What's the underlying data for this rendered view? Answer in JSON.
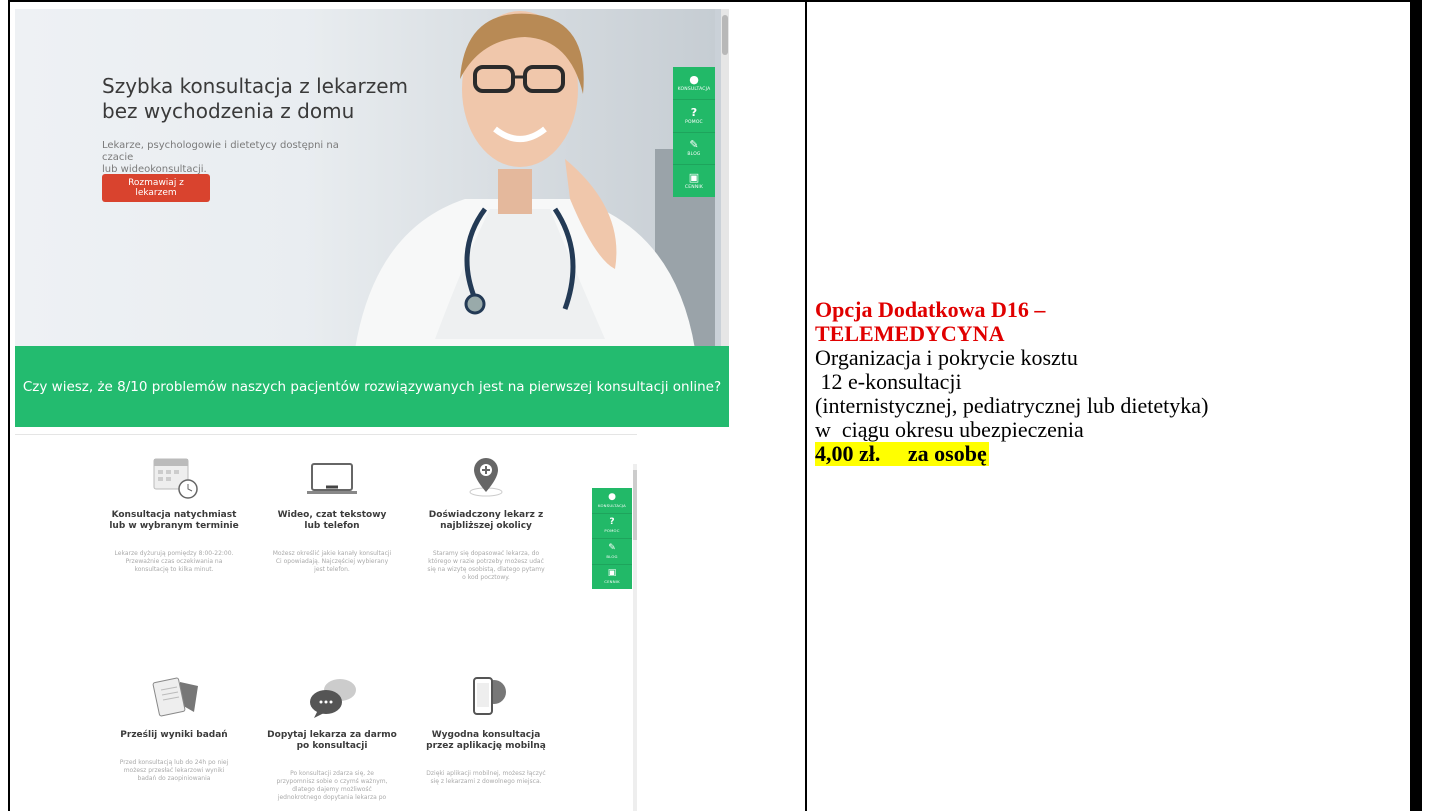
{
  "hero": {
    "title_line1": "Szybka konsultacja z lekarzem",
    "title_line2": "bez wychodzenia z domu",
    "subtitle_line1": "Lekarze, psychologowie i dietetycy dostępni na czacie",
    "subtitle_line2": "lub wideokonsultacji.",
    "cta_label": "Rozmawiaj z lekarzem",
    "band_text": "Czy wiesz, że 8/10 problemów naszych pacjentów rozwiązywanych jest na pierwszej konsultacji online?"
  },
  "sidebar": {
    "items": [
      {
        "label": "KONSULTACJA",
        "icon": "chat-bubble-icon"
      },
      {
        "label": "POMOC",
        "icon": "question-icon"
      },
      {
        "label": "BLOG",
        "icon": "edit-icon"
      },
      {
        "label": "CENNIK",
        "icon": "money-icon"
      }
    ]
  },
  "features": [
    {
      "icon": "calendar-clock-icon",
      "title_line1": "Konsultacja natychmiast",
      "title_line2": "lub w wybranym terminie",
      "desc": [
        "Lekarze dyżurują pomiędzy 8:00-22:00.",
        "Przeważnie czas oczekiwania na",
        "konsultację to kilka minut."
      ]
    },
    {
      "icon": "laptop-icon",
      "title_line1": "Wideo, czat tekstowy",
      "title_line2": "lub telefon",
      "desc": [
        "Możesz określić jakie kanały konsultacji",
        "Ci opowiadają. Najczęściej wybierany",
        "jest telefon."
      ]
    },
    {
      "icon": "location-pin-icon",
      "title_line1": "Doświadczony lekarz z",
      "title_line2": "najbliższej okolicy",
      "desc": [
        "Staramy się dopasować lekarza, do",
        "którego w razie potrzeby możesz udać",
        "się na wizytę osobistą, dlatego pytamy",
        "o kod pocztowy."
      ]
    },
    {
      "icon": "clipboard-icon",
      "title_line1": "Prześlij wyniki badań",
      "title_line2": "",
      "desc": [
        "Przed konsultacją lub do 24h po niej",
        "możesz przesłać lekarzowi wyniki",
        "badań do zaopiniowania"
      ]
    },
    {
      "icon": "speech-bubbles-icon",
      "title_line1": "Dopytaj lekarza za darmo",
      "title_line2": "po konsultacji",
      "desc": [
        "Po konsultacji zdarza się, że",
        "przypomnisz sobie o czymś ważnym,",
        "dlatego dajemy możliwość",
        "jednokrotnego dopytania lekarza po"
      ]
    },
    {
      "icon": "mobile-globe-icon",
      "title_line1": "Wygodna konsultacja",
      "title_line2": "przez aplikację mobilną",
      "desc": [
        "Dzięki aplikacji mobilnej, możesz łączyć",
        "się z lekarzami z dowolnego miejsca."
      ]
    }
  ],
  "offer": {
    "title_line1": "Opcja Dodatkowa D16 –",
    "title_line2": "TELEMEDYCYNA",
    "line1": "Organizacja i pokrycie kosztu",
    "line2": " 12 e-konsultacji",
    "line3": "(internistycznej, pediatrycznej lub dietetyka)",
    "line4": "w  ciągu okresu ubezpieczenia",
    "price": "4,00 zł.     za osobę"
  },
  "colors": {
    "green": "#23bb6f",
    "cta": "#d9432e",
    "offer_title": "#e00000",
    "highlight": "#ffff00"
  }
}
